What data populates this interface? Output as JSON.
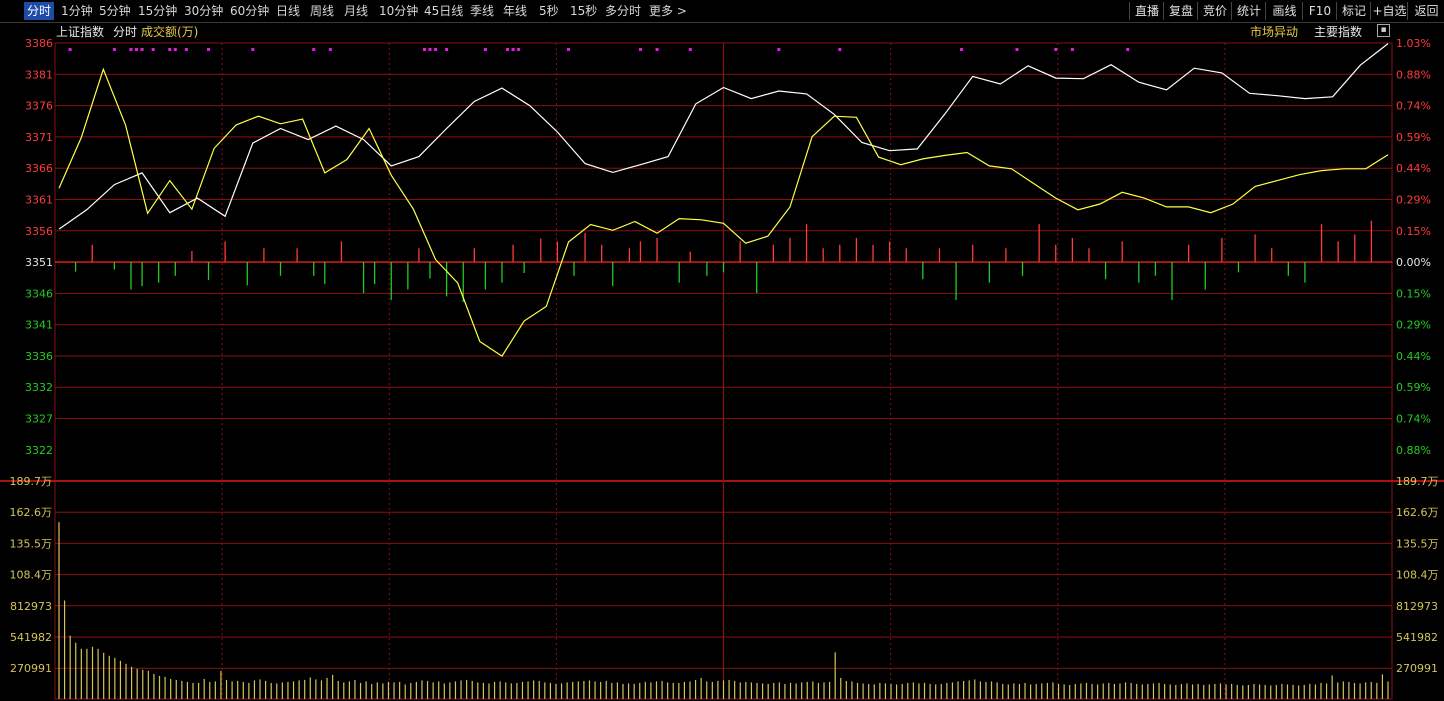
{
  "toolbar": {
    "tabs": [
      "分时",
      "1分钟",
      "5分钟",
      "15分钟",
      "30分钟",
      "60分钟",
      "日线",
      "周线",
      "月线",
      "10分钟",
      "45日线",
      "季线",
      "年线",
      "5秒",
      "15秒",
      "多分时",
      "更多 >"
    ],
    "right_buttons": [
      "直播",
      "复盘",
      "竞价",
      "统计",
      "画线",
      "F10",
      "标记",
      "+自选",
      "返回"
    ]
  },
  "subheader": {
    "index_name": "上证指数",
    "mode": "分时",
    "volume_label": "成交额(万)",
    "market_anomaly": "市场异动",
    "main_index": "主要指数"
  },
  "colors": {
    "up": "#ff3b3b",
    "down": "#22cc22",
    "grid": "#8a1010",
    "price_line": "#ffffff",
    "avg_line": "#ffff44",
    "volume": "#d4c45a",
    "marker": "#e020e0"
  },
  "chart_data": {
    "type": "line",
    "base_price": 3351,
    "price_axis_left": {
      "up": [
        "3386",
        "3381",
        "3376",
        "3371",
        "3366",
        "3361",
        "3356"
      ],
      "mid": "3351",
      "down": [
        "3346",
        "3341",
        "3336",
        "3332",
        "3327",
        "3322"
      ]
    },
    "pct_axis_right": {
      "up": [
        "1.03%",
        "0.88%",
        "0.74%",
        "0.59%",
        "0.44%",
        "0.29%",
        "0.15%"
      ],
      "mid": "0.00%",
      "down": [
        "0.15%",
        "0.29%",
        "0.44%",
        "0.59%",
        "0.74%",
        "0.88%"
      ]
    },
    "volume_axis": [
      "189.7万",
      "162.6万",
      "135.5万",
      "108.4万",
      "812973",
      "541982",
      "270991"
    ],
    "volume_ylim": [
      0,
      2169000
    ],
    "price_ylim": [
      3316.5,
      3386
    ],
    "series": [
      {
        "role": "price",
        "x": [
          0,
          5,
          10,
          15,
          20,
          25,
          30,
          35,
          40,
          45,
          50,
          55,
          60,
          65,
          70,
          75,
          80,
          85,
          90,
          95,
          100,
          105,
          110,
          115,
          120,
          125,
          130,
          135,
          140,
          145,
          150,
          155,
          160,
          165,
          170,
          175,
          180,
          185,
          190,
          195,
          200,
          205,
          210,
          215,
          220,
          225,
          230,
          235,
          240
        ],
        "values": [
          3354.2,
          3357.5,
          3361.8,
          3363.8,
          3357.0,
          3359.5,
          3356.4,
          3368.9,
          3371.4,
          3369.5,
          3371.8,
          3369.5,
          3365.0,
          3366.6,
          3371.4,
          3376.0,
          3378.3,
          3375.3,
          3370.8,
          3365.4,
          3363.9,
          3365.2,
          3366.6,
          3375.6,
          3378.4,
          3376.5,
          3377.8,
          3377.3,
          3373.8,
          3369.0,
          3367.6,
          3367.9,
          3373.9,
          3380.3,
          3379.0,
          3382.1,
          3380.0,
          3379.9,
          3382.3,
          3379.3,
          3378.0,
          3381.7,
          3380.9,
          3377.4,
          3377.0,
          3376.5,
          3376.8,
          3382.2,
          3385.9
        ]
      },
      {
        "role": "average",
        "x": [
          0,
          4,
          8,
          12,
          16,
          20,
          24,
          28,
          32,
          36,
          40,
          44,
          48,
          52,
          56,
          60,
          64,
          68,
          72,
          76,
          80,
          84,
          88,
          92,
          96,
          100,
          104,
          108,
          112,
          116,
          120,
          124,
          128,
          132,
          136,
          140,
          144,
          148,
          152,
          156,
          160,
          164,
          168,
          172,
          176,
          180,
          184,
          188,
          192,
          196,
          200,
          204,
          208,
          212,
          216,
          220,
          224,
          228,
          232,
          236,
          240
        ],
        "values": [
          3361.2,
          3369.8,
          3381.5,
          3372.0,
          3356.9,
          3362.5,
          3357.6,
          3368.0,
          3372.0,
          3373.5,
          3372.2,
          3373.0,
          3363.8,
          3366.1,
          3371.4,
          3363.4,
          3357.6,
          3349.0,
          3345.0,
          3335.0,
          3332.5,
          3338.5,
          3341.0,
          3352.0,
          3355.0,
          3354.0,
          3355.5,
          3353.5,
          3356.0,
          3355.8,
          3355.2,
          3351.8,
          3353.0,
          3358.0,
          3370.0,
          3373.5,
          3373.3,
          3366.5,
          3365.2,
          3366.2,
          3366.8,
          3367.3,
          3365.0,
          3364.5,
          3362.0,
          3359.5,
          3357.5,
          3358.5,
          3360.5,
          3359.5,
          3358.0,
          3358.0,
          3357.0,
          3358.5,
          3361.5,
          3362.5,
          3363.5,
          3364.2,
          3364.5,
          3364.5,
          3366.9
        ]
      }
    ],
    "volume": [
      1760000,
      980000,
      630000,
      560000,
      500000,
      500000,
      520000,
      500000,
      460000,
      430000,
      410000,
      380000,
      350000,
      320000,
      300000,
      290000,
      280000,
      250000,
      230000,
      220000,
      200000,
      190000,
      180000,
      170000,
      160000,
      160000,
      200000,
      170000,
      175000,
      280000,
      190000,
      175000,
      180000,
      170000,
      160000,
      185000,
      195000,
      180000,
      160000,
      155000,
      165000,
      170000,
      175000,
      185000,
      190000,
      215000,
      195000,
      185000,
      210000,
      240000,
      180000,
      165000,
      175000,
      190000,
      160000,
      175000,
      150000,
      165000,
      155000,
      170000,
      165000,
      170000,
      145000,
      160000,
      170000,
      185000,
      180000,
      165000,
      175000,
      155000,
      165000,
      175000,
      185000,
      190000,
      180000,
      165000,
      160000,
      155000,
      170000,
      175000,
      165000,
      155000,
      160000,
      170000,
      175000,
      185000,
      180000,
      165000,
      160000,
      150000,
      155000,
      165000,
      170000,
      175000,
      180000,
      185000,
      175000,
      170000,
      180000,
      160000,
      165000,
      150000,
      155000,
      150000,
      160000,
      170000,
      165000,
      175000,
      180000,
      165000,
      160000,
      160000,
      170000,
      175000,
      190000,
      210000,
      175000,
      170000,
      180000,
      185000,
      190000,
      180000,
      165000,
      170000,
      165000,
      160000,
      155000,
      150000,
      160000,
      165000,
      150000,
      160000,
      155000,
      165000,
      170000,
      175000,
      160000,
      165000,
      170000,
      465000,
      210000,
      180000,
      175000,
      160000,
      155000,
      150000,
      145000,
      160000,
      155000,
      150000,
      145000,
      150000,
      160000,
      165000,
      155000,
      160000,
      150000,
      145000,
      150000,
      160000,
      165000,
      175000,
      180000,
      185000,
      195000,
      175000,
      170000,
      175000,
      165000,
      150000,
      145000,
      155000,
      150000,
      160000,
      145000,
      150000,
      155000,
      160000,
      165000,
      150000,
      145000,
      140000,
      150000,
      155000,
      160000,
      150000,
      145000,
      155000,
      160000,
      150000,
      155000,
      165000,
      160000,
      150000,
      145000,
      150000,
      155000,
      160000,
      150000,
      145000,
      140000,
      150000,
      155000,
      145000,
      150000,
      140000,
      145000,
      150000,
      155000,
      145000,
      150000,
      140000,
      135000,
      140000,
      150000,
      145000,
      140000,
      135000,
      140000,
      150000,
      145000,
      140000,
      135000,
      140000,
      150000,
      145000,
      160000,
      155000,
      235000,
      165000,
      175000,
      170000,
      160000,
      155000,
      165000,
      170000,
      160000,
      245000,
      175000
    ],
    "volume_candles": [
      {
        "x": 3,
        "v": -0.14
      },
      {
        "x": 6,
        "v": 0.25
      },
      {
        "x": 10,
        "v": -0.11
      },
      {
        "x": 13,
        "v": -0.4
      },
      {
        "x": 15,
        "v": -0.35
      },
      {
        "x": 18,
        "v": -0.3
      },
      {
        "x": 21,
        "v": -0.2
      },
      {
        "x": 24,
        "v": 0.16
      },
      {
        "x": 27,
        "v": -0.26
      },
      {
        "x": 30,
        "v": 0.3
      },
      {
        "x": 34,
        "v": -0.34
      },
      {
        "x": 37,
        "v": 0.2
      },
      {
        "x": 40,
        "v": -0.2
      },
      {
        "x": 43,
        "v": 0.2
      },
      {
        "x": 46,
        "v": -0.2
      },
      {
        "x": 48,
        "v": -0.32
      },
      {
        "x": 51,
        "v": 0.3
      },
      {
        "x": 55,
        "v": -0.45
      },
      {
        "x": 57,
        "v": -0.32
      },
      {
        "x": 60,
        "v": -0.55
      },
      {
        "x": 63,
        "v": -0.4
      },
      {
        "x": 65,
        "v": 0.2
      },
      {
        "x": 67,
        "v": -0.24
      },
      {
        "x": 70,
        "v": -0.5
      },
      {
        "x": 73,
        "v": -0.58
      },
      {
        "x": 75,
        "v": 0.2
      },
      {
        "x": 77,
        "v": -0.4
      },
      {
        "x": 80,
        "v": -0.3
      },
      {
        "x": 82,
        "v": 0.25
      },
      {
        "x": 84,
        "v": -0.16
      },
      {
        "x": 87,
        "v": 0.34
      },
      {
        "x": 90,
        "v": 0.3
      },
      {
        "x": 93,
        "v": -0.2
      },
      {
        "x": 95,
        "v": 0.42
      },
      {
        "x": 98,
        "v": 0.25
      },
      {
        "x": 100,
        "v": -0.35
      },
      {
        "x": 103,
        "v": 0.2
      },
      {
        "x": 105,
        "v": 0.3
      },
      {
        "x": 108,
        "v": 0.35
      },
      {
        "x": 112,
        "v": -0.3
      },
      {
        "x": 114,
        "v": 0.15
      },
      {
        "x": 117,
        "v": -0.2
      },
      {
        "x": 120,
        "v": -0.15
      },
      {
        "x": 123,
        "v": 0.3
      },
      {
        "x": 126,
        "v": -0.45
      },
      {
        "x": 129,
        "v": 0.25
      },
      {
        "x": 132,
        "v": 0.35
      },
      {
        "x": 135,
        "v": 0.55
      },
      {
        "x": 138,
        "v": 0.2
      },
      {
        "x": 141,
        "v": 0.25
      },
      {
        "x": 144,
        "v": 0.35
      },
      {
        "x": 147,
        "v": 0.25
      },
      {
        "x": 150,
        "v": 0.3
      },
      {
        "x": 153,
        "v": 0.2
      },
      {
        "x": 156,
        "v": -0.25
      },
      {
        "x": 159,
        "v": 0.2
      },
      {
        "x": 162,
        "v": -0.55
      },
      {
        "x": 165,
        "v": 0.25
      },
      {
        "x": 168,
        "v": -0.3
      },
      {
        "x": 171,
        "v": 0.2
      },
      {
        "x": 174,
        "v": -0.2
      },
      {
        "x": 177,
        "v": 0.55
      },
      {
        "x": 180,
        "v": 0.25
      },
      {
        "x": 183,
        "v": 0.35
      },
      {
        "x": 186,
        "v": 0.2
      },
      {
        "x": 189,
        "v": -0.25
      },
      {
        "x": 192,
        "v": 0.3
      },
      {
        "x": 195,
        "v": -0.3
      },
      {
        "x": 198,
        "v": -0.2
      },
      {
        "x": 201,
        "v": -0.55
      },
      {
        "x": 204,
        "v": 0.25
      },
      {
        "x": 207,
        "v": -0.4
      },
      {
        "x": 210,
        "v": 0.35
      },
      {
        "x": 213,
        "v": -0.15
      },
      {
        "x": 216,
        "v": 0.4
      },
      {
        "x": 219,
        "v": 0.2
      },
      {
        "x": 222,
        "v": -0.2
      },
      {
        "x": 225,
        "v": -0.3
      },
      {
        "x": 228,
        "v": 0.55
      },
      {
        "x": 231,
        "v": 0.3
      },
      {
        "x": 234,
        "v": 0.4
      },
      {
        "x": 237,
        "v": 0.6
      }
    ],
    "markers_x": [
      2,
      10,
      13,
      14,
      15,
      17,
      20,
      21,
      23,
      27,
      35,
      46,
      49,
      66,
      67,
      68,
      70,
      77,
      81,
      82,
      83,
      92,
      105,
      108,
      114,
      130,
      141,
      163,
      173,
      180,
      183,
      193
    ]
  }
}
